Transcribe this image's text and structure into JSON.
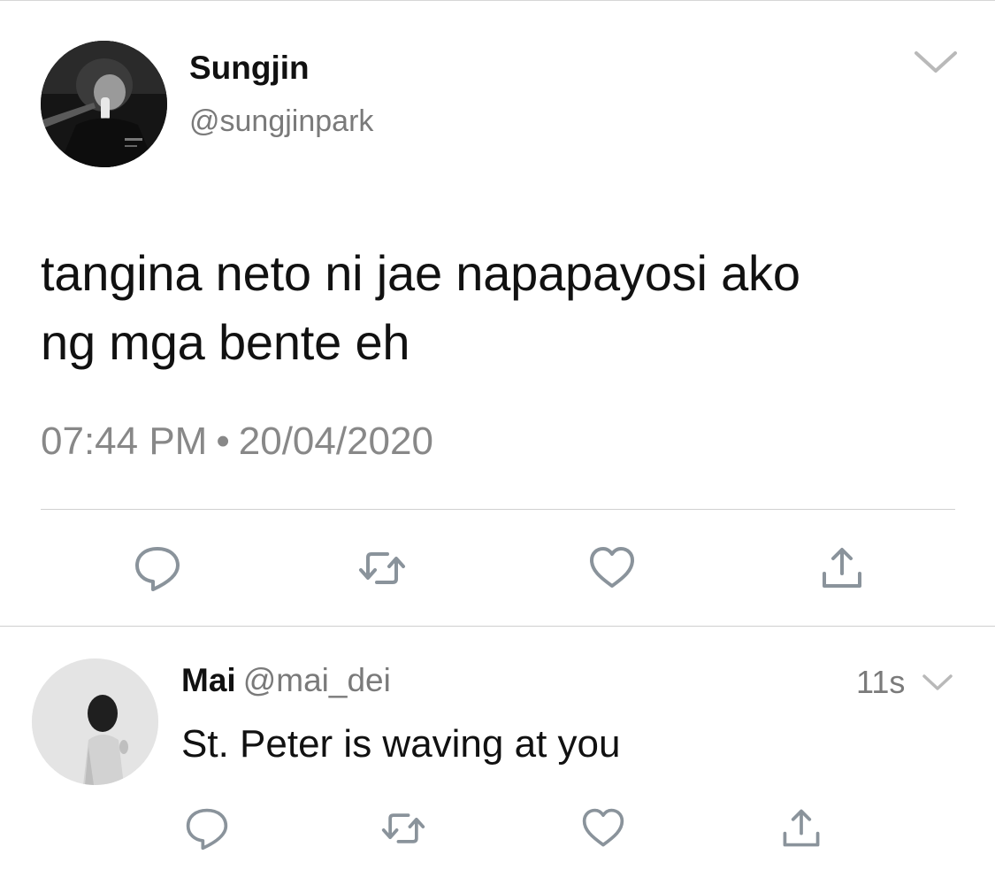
{
  "tweet": {
    "author_name": "Sungjin",
    "author_handle": "@sungjinpark",
    "text_line1": "tangina neto ni jae napapayosi ako",
    "text_line2": "ng mga bente eh",
    "time": "07:44 PM",
    "separator": "•",
    "date": "20/04/2020",
    "menu_icon": "chevron-down-icon",
    "actions": [
      "reply-icon",
      "retweet-icon",
      "like-icon",
      "share-icon"
    ]
  },
  "reply": {
    "author_name": "Mai",
    "author_handle": "@mai_dei",
    "time": "11s",
    "text": "St. Peter is waving at you",
    "menu_icon": "chevron-down-icon",
    "actions": [
      "reply-icon",
      "retweet-icon",
      "like-icon",
      "share-icon"
    ]
  },
  "colors": {
    "text_primary": "#111111",
    "text_secondary": "#7a7a7a",
    "icon_gray": "#8a939b",
    "divider": "#d0d0d0",
    "background": "#ffffff"
  }
}
